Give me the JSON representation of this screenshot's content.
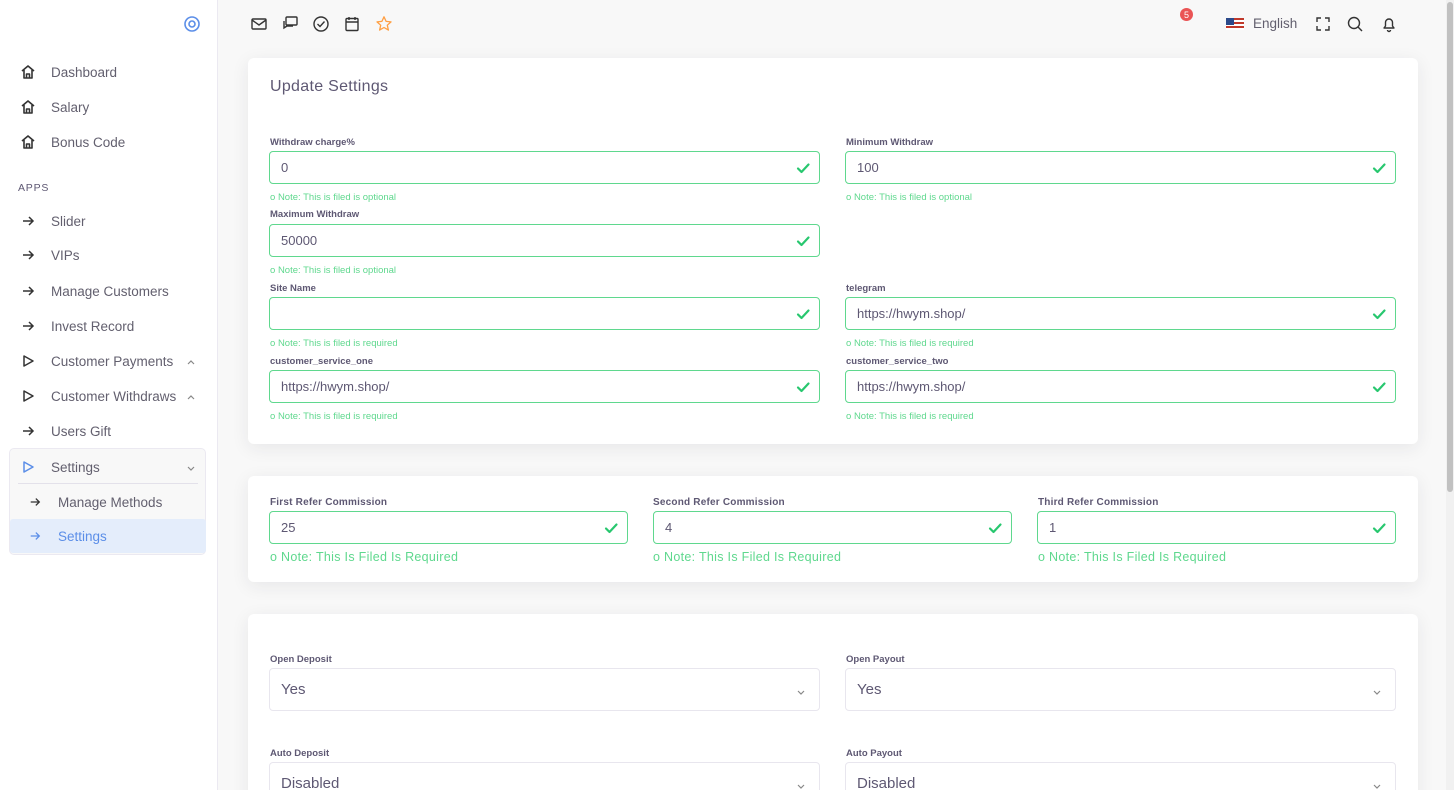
{
  "sidebar": {
    "main_items": [
      {
        "label": "Dashboard",
        "icon": "home-icon"
      },
      {
        "label": "Salary",
        "icon": "home-icon"
      },
      {
        "label": "Bonus Code",
        "icon": "home-icon"
      }
    ],
    "apps_label": "APPS",
    "app_items": [
      {
        "label": "Slider",
        "icon": "arrow-right-icon"
      },
      {
        "label": "VIPs",
        "icon": "arrow-right-icon"
      },
      {
        "label": "Manage Customers",
        "icon": "arrow-right-icon"
      },
      {
        "label": "Invest Record",
        "icon": "arrow-right-icon"
      },
      {
        "label": "Customer Payments",
        "icon": "play-icon"
      },
      {
        "label": "Customer Withdraws",
        "icon": "play-icon"
      },
      {
        "label": "Users Gift",
        "icon": "arrow-right-icon"
      },
      {
        "label": "Settings",
        "icon": "play-icon"
      }
    ],
    "settings_sub": [
      {
        "label": "Manage Methods"
      },
      {
        "label": "Settings"
      }
    ]
  },
  "topbar": {
    "language": "English",
    "notification_count": "5",
    "icons": [
      "mail-icon",
      "chat-icon",
      "check-circle-icon",
      "calendar-icon",
      "star-icon",
      "fullscreen-icon",
      "search-icon",
      "bell-icon"
    ]
  },
  "settings_card": {
    "title": "Update Settings",
    "withdraw_charge": {
      "label": "Withdraw charge%",
      "value": "0",
      "note": "Note: This is filed is optional"
    },
    "minimum_withdraw": {
      "label": "Minimum Withdraw",
      "value": "100",
      "note": "Note: This is filed is optional"
    },
    "maximum_withdraw": {
      "label": "Maximum Withdraw",
      "value": "50000",
      "note": "Note: This is filed is optional"
    },
    "site_name": {
      "label": "Site Name",
      "value": "",
      "note": "Note: This is filed is required"
    },
    "telegram": {
      "label": "telegram",
      "value": "https://hwym.shop/",
      "note": "Note: This is filed is required"
    },
    "customer_service_one": {
      "label": "customer_service_one",
      "value": "https://hwym.shop/",
      "note": "Note: This is filed is required"
    },
    "customer_service_two": {
      "label": "customer_service_two",
      "value": "https://hwym.shop/",
      "note": "Note: This is filed is required"
    }
  },
  "refer_card": {
    "first": {
      "label": "First Refer Commission",
      "value": "25",
      "note": "Note: This Is Filed Is Required"
    },
    "second": {
      "label": "Second Refer Commission",
      "value": "4",
      "note": "Note: This Is Filed Is Required"
    },
    "third": {
      "label": "Third Refer Commission",
      "value": "1",
      "note": "Note: This Is Filed Is Required"
    }
  },
  "options_card": {
    "open_deposit": {
      "label": "Open Deposit",
      "value": "Yes"
    },
    "open_payout": {
      "label": "Open Payout",
      "value": "Yes"
    },
    "auto_deposit": {
      "label": "Auto Deposit",
      "value": "Disabled"
    },
    "auto_payout": {
      "label": "Auto Payout",
      "value": "Disabled"
    }
  },
  "colors": {
    "success": "#5fd88e",
    "accent": "#5b8ee8",
    "warning": "#ff9f43",
    "badge": "#ea5455"
  }
}
